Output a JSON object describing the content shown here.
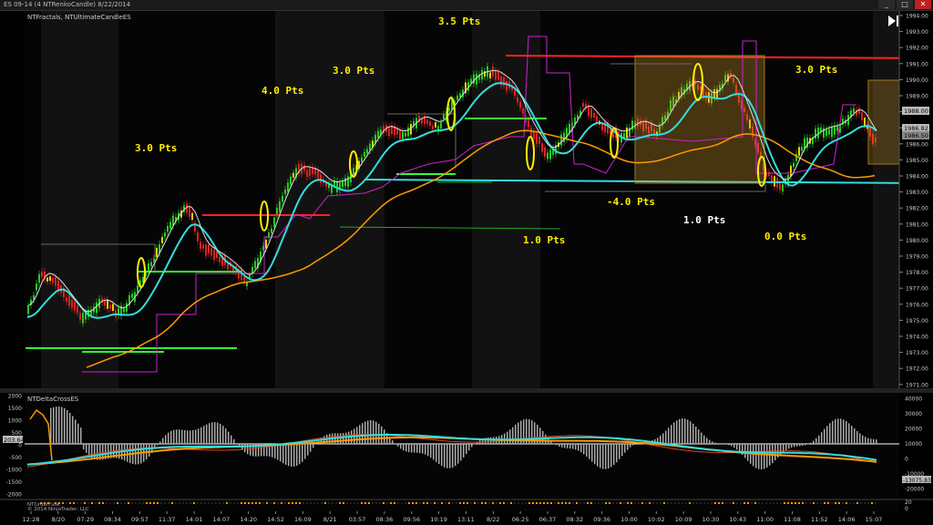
{
  "window": {
    "title": "ES 09-14 (4 NTRenkoCandle)  8/22/2014",
    "btn_min": "_",
    "btn_max": "□",
    "btn_close": "✕"
  },
  "main_panel": {
    "indicator_label": "NTFractals, NTUltimateCandleES",
    "yaxis_ticks": [
      "1994.00",
      "1993.00",
      "1992.00",
      "1991.00",
      "1990.00",
      "1989.00",
      "1988.00",
      "1987.00",
      "1986.00",
      "1985.00",
      "1984.00",
      "1983.00",
      "1982.00",
      "1981.00",
      "1980.00",
      "1979.00",
      "1978.00",
      "1977.00",
      "1976.00",
      "1975.00",
      "1974.00",
      "1973.00",
      "1972.00",
      "1971.00"
    ],
    "price_flags": [
      "1988.00",
      "1986.82",
      "1986.50"
    ],
    "annotations": [
      "3.0 Pts",
      "4.0 Pts",
      "3.0 Pts",
      "3.5 Pts",
      "3.0 Pts",
      "-4.0 Pts",
      "1.0 Pts",
      "0.0 Pts",
      "1.0 Pts"
    ]
  },
  "lower_panel": {
    "indicator_label": "NTDeltaCrossES",
    "left_ticks": [
      "2000",
      "1500",
      "1000",
      "500",
      "0",
      "-500",
      "-1000",
      "-1500",
      "-2000"
    ],
    "left_flag": "203.64",
    "right_ticks": [
      "40000",
      "30000",
      "20000",
      "10000",
      "0",
      "-10000",
      "-20000"
    ],
    "right_flag": "-13075.83"
  },
  "footer": {
    "label": "NTOrderFlow",
    "copyright": "© 2014 NinjaTrader, LLC",
    "right_ticks": [
      "20",
      "0"
    ]
  },
  "xaxis_labels": [
    "12:28",
    "8/20",
    "07:29",
    "08:34",
    "09:57",
    "11:37",
    "14:01",
    "14:07",
    "14:20",
    "14:52",
    "16:09",
    "8/21",
    "03:57",
    "08:36",
    "09:56",
    "10:19",
    "13:11",
    "8/22",
    "06:25",
    "06:37",
    "08:32",
    "09:36",
    "10:00",
    "10:02",
    "10:09",
    "10:30",
    "10:43",
    "11:00",
    "11:08",
    "11:52",
    "14:06",
    "15:07"
  ],
  "colors": {
    "up": "#22cc22",
    "down": "#dd2222",
    "cyan": "#33dddd",
    "orange": "#ff9900",
    "annotation": "#ffee00"
  }
}
